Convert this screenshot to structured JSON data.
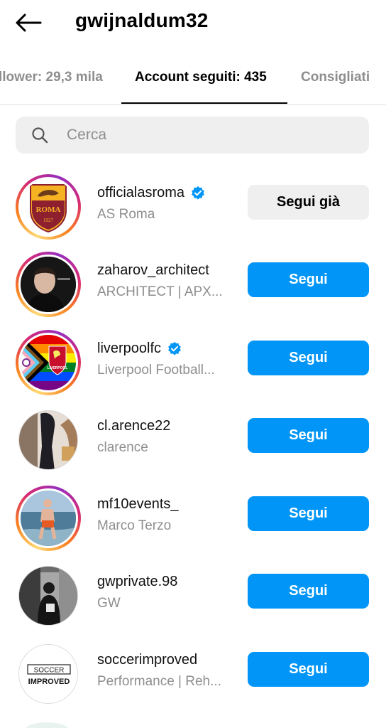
{
  "header": {
    "title": "gwijnaldum32",
    "back_icon": "arrow-left-icon"
  },
  "tabs": [
    {
      "label": "llower: 29,3 mila",
      "active": false
    },
    {
      "label": "Account seguiti: 435",
      "active": true
    },
    {
      "label": "Consigliati",
      "active": false
    }
  ],
  "search": {
    "placeholder": "Cerca",
    "icon": "search-icon"
  },
  "accounts": [
    {
      "username": "officialasroma",
      "full_name": "AS Roma",
      "verified": true,
      "button": "Segui già",
      "is_following": true,
      "story_ring": true
    },
    {
      "username": "zaharov_architect",
      "full_name": "ARCHITECT | APX...",
      "verified": false,
      "button": "Segui",
      "is_following": false,
      "story_ring": true
    },
    {
      "username": "liverpoolfc",
      "full_name": "Liverpool Football...",
      "verified": true,
      "button": "Segui",
      "is_following": false,
      "story_ring": true
    },
    {
      "username": "cl.arence22",
      "full_name": "clarence",
      "verified": false,
      "button": "Segui",
      "is_following": false,
      "story_ring": false
    },
    {
      "username": "mf10events_",
      "full_name": "Marco Terzo",
      "verified": false,
      "button": "Segui",
      "is_following": false,
      "story_ring": true
    },
    {
      "username": "gwprivate.98",
      "full_name": "GW",
      "verified": false,
      "button": "Segui",
      "is_following": false,
      "story_ring": false
    },
    {
      "username": "soccerimproved",
      "full_name": "Performance | Reh...",
      "verified": false,
      "button": "Segui",
      "is_following": false,
      "story_ring": false
    }
  ],
  "avatar_text": {
    "roma_wordmark": "ROMA",
    "roma_year": "1927",
    "lfc_wordmark": "LIVERPOOL",
    "soccer_line1": "SOCCER",
    "soccer_line2": "IMPROVED"
  },
  "colors": {
    "primary_button": "#0095f6",
    "secondary_button": "#efefef",
    "verified": "#0095f6",
    "muted_text": "#8e8e8e"
  }
}
